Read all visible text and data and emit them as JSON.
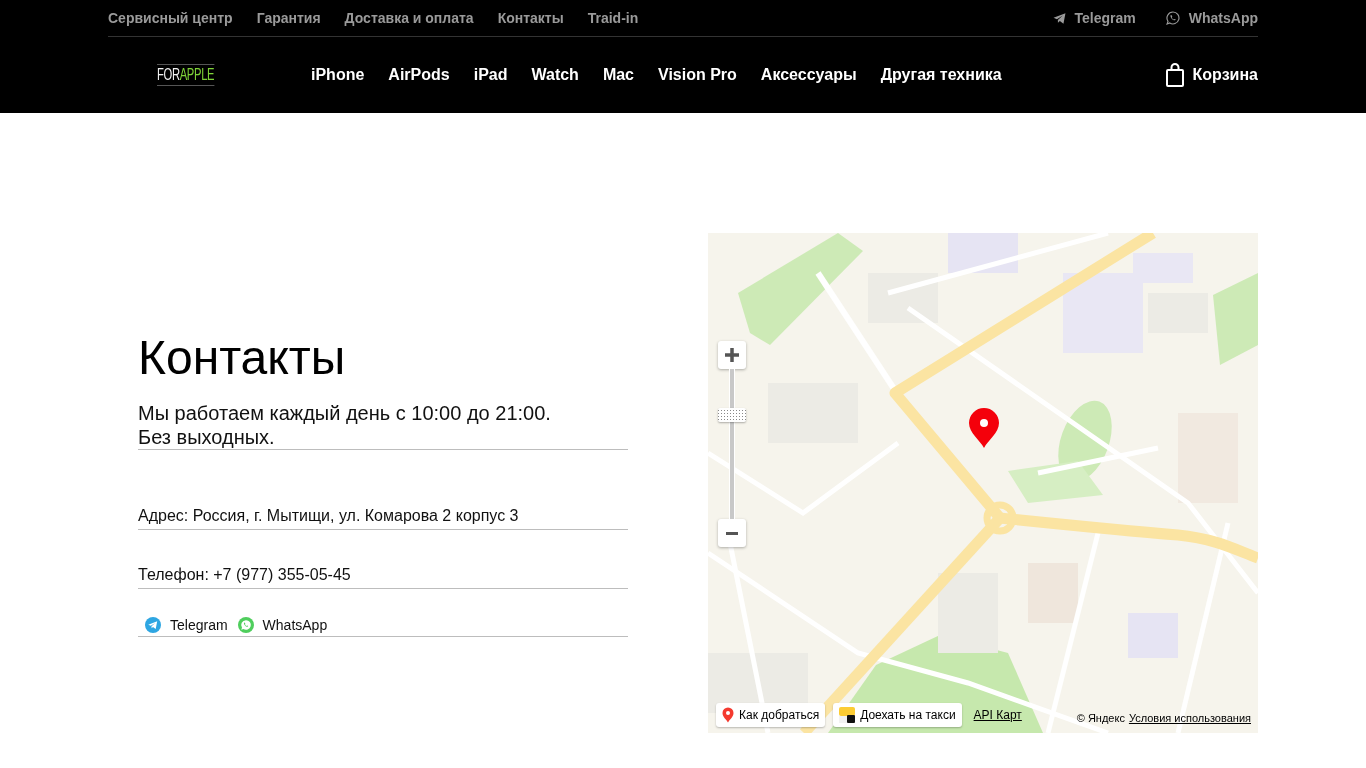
{
  "top_bar": {
    "links": [
      "Сервисный центр",
      "Гарантия",
      "Доставка и оплата",
      "Контакты",
      "Traid-in"
    ],
    "messengers": [
      {
        "kind": "telegram",
        "label": "Telegram"
      },
      {
        "kind": "whatsapp",
        "label": "WhatsApp"
      }
    ]
  },
  "nav": {
    "logo": {
      "prefix": "FOR",
      "accent": "APPLE"
    },
    "items": [
      "iPhone",
      "AirPods",
      "iPad",
      "Watch",
      "Mac",
      "Vision Pro",
      "Аксессуары",
      "Другая техника"
    ],
    "cart": "Корзина"
  },
  "contacts": {
    "title": "Контакты",
    "hours": [
      "Мы работаем каждый день с 10:00 до 21:00.",
      "Без выходных."
    ],
    "address": "Адрес: Россия, г. Мытищи, ул. Комарова 2 корпус 3",
    "phone": "Телефон: +7 (977) 355-05-45",
    "messengers": [
      {
        "kind": "telegram",
        "label": "Telegram"
      },
      {
        "kind": "whatsapp",
        "label": "WhatsApp"
      }
    ]
  },
  "map": {
    "zoom_slider": {
      "level": 0.71
    },
    "buttons": [
      {
        "kind": "route",
        "label": "Как добраться"
      },
      {
        "kind": "taxi",
        "label": "Доехать на такси"
      }
    ],
    "api_link": "API Карт",
    "copyright": "© Яндекс",
    "terms_link": "Условия использования"
  }
}
